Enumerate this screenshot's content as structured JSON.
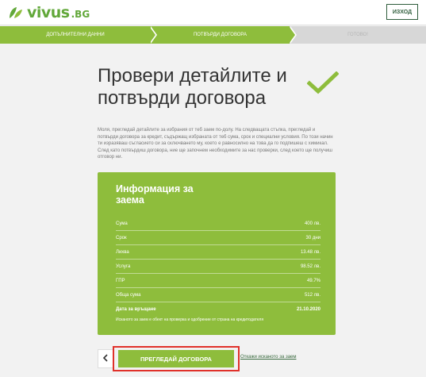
{
  "header": {
    "logo_text": "vivus",
    "logo_suffix": ".BG",
    "exit_label": "ИЗХОД"
  },
  "steps": [
    {
      "label": "ДОПЪЛНИТЕЛНИ ДАННИ",
      "state": "done"
    },
    {
      "label": "ПОТВЪРДИ ДОГОВОРА",
      "state": "active"
    },
    {
      "label": "ГОТОВО!",
      "state": "pending"
    }
  ],
  "main": {
    "title": "Провери детайлите и потвърди договора",
    "intro_1": "Моля, прегледай детайлите за избрания от теб заем по-долу. На следващата стъпка, прегледай и потвърди договора за кредит, съдържащ избраната от теб сума, срок и специални условия. По този начин ти изразяваш съгласието си за сключването му, което е равносилно на това да го подпишеш с химикал.",
    "intro_2": "След като потвърдиш договора, ние ще започнем необходимите за нас проверки, след което ще получиш отговор ни."
  },
  "card": {
    "title": "Информация за заема",
    "rows": [
      {
        "label": "Сума",
        "value": "400 лв."
      },
      {
        "label": "Срок",
        "value": "30 дни"
      },
      {
        "label": "Лихва",
        "value": "13.48 лв."
      },
      {
        "label": "Услуга",
        "value": "98.52 лв."
      },
      {
        "label": "ГПР",
        "value": "49.7%"
      },
      {
        "label": "Обща сума",
        "value": "512 лв."
      },
      {
        "label": "Дата за връщане",
        "value": "21.10.2020"
      }
    ],
    "note": "Исканото за заем е обект на проверка и одобрение от страна на кредитодателя"
  },
  "actions": {
    "back_label": "‹",
    "review_label": "ПРЕГЛЕДАЙ ДОГОВОРА",
    "reject_label": "Откажи исканото за заем"
  },
  "colors": {
    "brand_green": "#8ebd3c",
    "dark_green": "#2f5d3c",
    "highlight_red": "#e0312a"
  }
}
